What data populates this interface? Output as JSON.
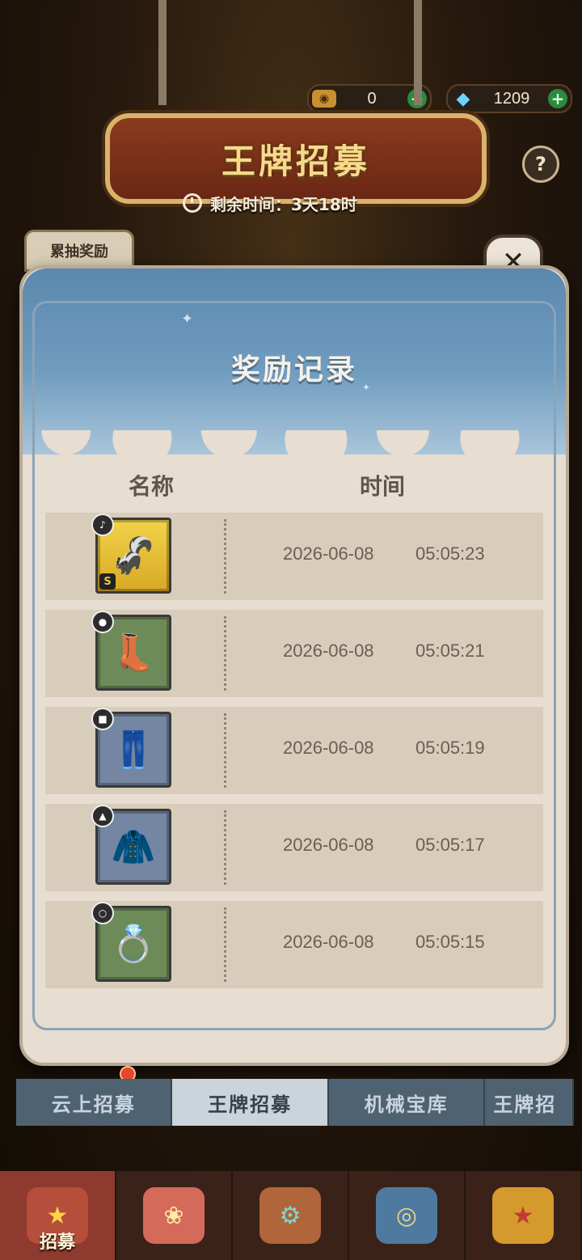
{
  "currency": {
    "tickets": "0",
    "gems": "1209"
  },
  "banner": {
    "title": "王牌招募",
    "timer_label": "剩余时间：3天18时"
  },
  "accum_tab": "累抽奖励",
  "modal": {
    "title": "奖励记录",
    "col_name": "名称",
    "col_time": "时间",
    "rows": [
      {
        "item": "character",
        "date": "2026-06-08",
        "time": "05:05:23",
        "rank": "S"
      },
      {
        "item": "boots",
        "date": "2026-06-08",
        "time": "05:05:21"
      },
      {
        "item": "pants",
        "date": "2026-06-08",
        "time": "05:05:19"
      },
      {
        "item": "jacket",
        "date": "2026-06-08",
        "time": "05:05:17"
      },
      {
        "item": "ring",
        "date": "2026-06-08",
        "time": "05:05:15"
      }
    ]
  },
  "tabs": [
    "云上招募",
    "王牌招募",
    "机械宝库",
    "王牌招"
  ],
  "nav": {
    "recruit_label": "招募"
  },
  "icons": {
    "help": "?",
    "close": "✕"
  }
}
